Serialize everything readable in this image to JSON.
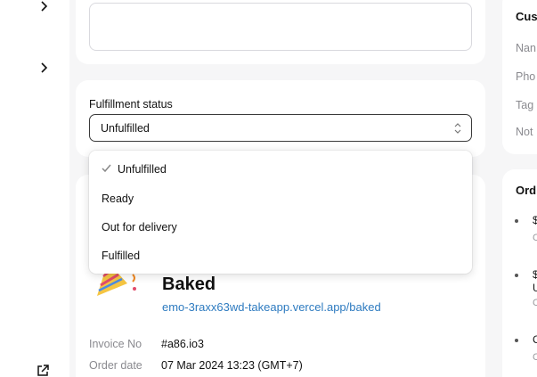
{
  "sidebar": {
    "icons": [
      "chevron-right-icon",
      "chevron-right-icon",
      "external-link-icon"
    ]
  },
  "fulfillment": {
    "label": "Fulfillment status",
    "selected": "Unfulfilled",
    "options": [
      "Unfulfilled",
      "Ready",
      "Out for delivery",
      "Fulfilled"
    ]
  },
  "invoice": {
    "store_name": "Baked",
    "store_link": "emo-3raxx63wd-takeapp.vercel.app/baked",
    "invoice_no_label": "Invoice No",
    "invoice_no": "#a86.io3",
    "order_date_label": "Order date",
    "order_date": "07 Mar 2024 13:23 (GMT+7)"
  },
  "customer": {
    "title": "Cus",
    "fields": [
      "Nan",
      "Pho",
      "Tag",
      "Not"
    ]
  },
  "orders": {
    "title": "Ord",
    "items": [
      {
        "text": "$",
        "sub": "C"
      },
      {
        "text": "$",
        "text2": "U",
        "sub": "C"
      },
      {
        "text": "C",
        "sub": "C"
      }
    ]
  },
  "colors": {
    "background": "#f6f6f7",
    "card": "#ffffff",
    "link": "#2e7bc0",
    "muted": "#8a8a8f"
  }
}
